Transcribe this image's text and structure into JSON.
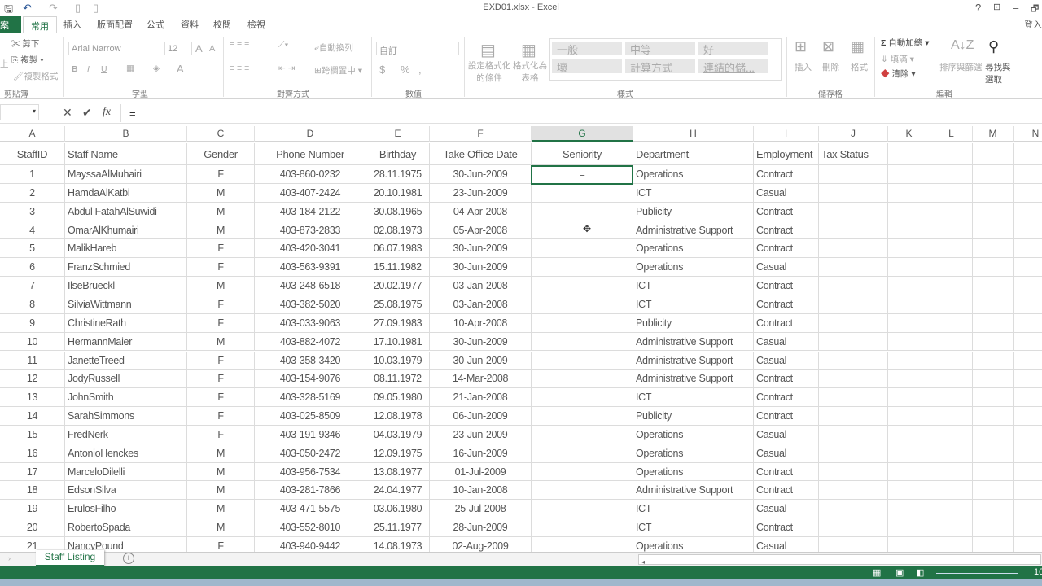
{
  "window": {
    "title": "EXD01.xlsx - Excel",
    "help": "?",
    "minimize": "–",
    "restore": "🗗",
    "signin": "登入"
  },
  "menu_tabs": [
    "案",
    "常用",
    "插入",
    "版面配置",
    "公式",
    "資料",
    "校閱",
    "檢視"
  ],
  "ribbon": {
    "clipboard": {
      "cut": "剪下",
      "copy": "複製",
      "format_painter": "複製格式",
      "paste": "上",
      "label": "剪貼簿"
    },
    "font": {
      "name": "Arial Narrow",
      "size": "12",
      "bold": "B",
      "italic": "I",
      "underline": "U",
      "grow": "A",
      "shrink": "A",
      "color": "A",
      "label": "字型"
    },
    "alignment": {
      "wrap": "自動換列",
      "merge": "跨欄置中",
      "label": "對齊方式"
    },
    "number": {
      "format": "自訂",
      "currency": "$",
      "percent": "%",
      "comma": ",",
      "label": "數值"
    },
    "styles": {
      "conditional": "設定格式化的條件",
      "as_table": "格式化為表格",
      "cells": [
        "一般",
        "中等",
        "好",
        "壞",
        "計算方式",
        "連結的儲..."
      ],
      "label": "樣式"
    },
    "cells": {
      "insert": "插入",
      "delete": "刪除",
      "format": "格式",
      "label": "儲存格"
    },
    "editing": {
      "autosum": "自動加總",
      "fill": "填滿",
      "clear": "清除",
      "sort": "排序與篩選",
      "find": "尋找與選取",
      "label": "編輯"
    }
  },
  "formula_bar": {
    "name_box": "",
    "cancel": "✕",
    "enter": "✔",
    "fx": "fx",
    "content": "="
  },
  "columns": [
    "A",
    "B",
    "C",
    "D",
    "E",
    "F",
    "G",
    "H",
    "I",
    "J",
    "K",
    "L",
    "M",
    "N"
  ],
  "selected_column": "G",
  "headers": [
    "StaffID",
    "Staff Name",
    "Gender",
    "Phone Number",
    "Birthday",
    "Take Office Date",
    "Seniority",
    "Department",
    "Employment",
    "Tax Status"
  ],
  "rows": [
    [
      "1",
      "MayssaAlMuhairi",
      "F",
      "403-860-0232",
      "28.11.1975",
      "30-Jun-2009",
      "=",
      "Operations",
      "Contract",
      ""
    ],
    [
      "2",
      "HamdaAlKatbi",
      "M",
      "403-407-2424",
      "20.10.1981",
      "23-Jun-2009",
      "",
      "ICT",
      "Casual",
      ""
    ],
    [
      "3",
      "Abdul FatahAlSuwidi",
      "M",
      "403-184-2122",
      "30.08.1965",
      "04-Apr-2008",
      "",
      "Publicity",
      "Contract",
      ""
    ],
    [
      "4",
      "OmarAlKhumairi",
      "M",
      "403-873-2833",
      "02.08.1973",
      "05-Apr-2008",
      "",
      "Administrative Support",
      "Contract",
      ""
    ],
    [
      "5",
      "MalikHareb",
      "F",
      "403-420-3041",
      "06.07.1983",
      "30-Jun-2009",
      "",
      "Operations",
      "Contract",
      ""
    ],
    [
      "6",
      "FranzSchmied",
      "F",
      "403-563-9391",
      "15.11.1982",
      "30-Jun-2009",
      "",
      "Operations",
      "Casual",
      ""
    ],
    [
      "7",
      "IlseBrueckl",
      "M",
      "403-248-6518",
      "20.02.1977",
      "03-Jan-2008",
      "",
      "ICT",
      "Contract",
      ""
    ],
    [
      "8",
      "SilviaWittmann",
      "F",
      "403-382-5020",
      "25.08.1975",
      "03-Jan-2008",
      "",
      "ICT",
      "Contract",
      ""
    ],
    [
      "9",
      "ChristineRath",
      "F",
      "403-033-9063",
      "27.09.1983",
      "10-Apr-2008",
      "",
      "Publicity",
      "Contract",
      ""
    ],
    [
      "10",
      "HermannMaier",
      "M",
      "403-882-4072",
      "17.10.1981",
      "30-Jun-2009",
      "",
      "Administrative Support",
      "Casual",
      ""
    ],
    [
      "11",
      "JanetteTreed",
      "F",
      "403-358-3420",
      "10.03.1979",
      "30-Jun-2009",
      "",
      "Administrative Support",
      "Casual",
      ""
    ],
    [
      "12",
      "JodyRussell",
      "F",
      "403-154-9076",
      "08.11.1972",
      "14-Mar-2008",
      "",
      "Administrative Support",
      "Contract",
      ""
    ],
    [
      "13",
      "JohnSmith",
      "F",
      "403-328-5169",
      "09.05.1980",
      "21-Jan-2008",
      "",
      "ICT",
      "Contract",
      ""
    ],
    [
      "14",
      "SarahSimmons",
      "F",
      "403-025-8509",
      "12.08.1978",
      "06-Jun-2009",
      "",
      "Publicity",
      "Contract",
      ""
    ],
    [
      "15",
      "FredNerk",
      "F",
      "403-191-9346",
      "04.03.1979",
      "23-Jun-2009",
      "",
      "Operations",
      "Casual",
      ""
    ],
    [
      "16",
      "AntonioHenckes",
      "M",
      "403-050-2472",
      "12.09.1975",
      "16-Jun-2009",
      "",
      "Operations",
      "Casual",
      ""
    ],
    [
      "17",
      "MarceloDilelli",
      "M",
      "403-956-7534",
      "13.08.1977",
      "01-Jul-2009",
      "",
      "Operations",
      "Contract",
      ""
    ],
    [
      "18",
      "EdsonSilva",
      "M",
      "403-281-7866",
      "24.04.1977",
      "10-Jan-2008",
      "",
      "Administrative Support",
      "Contract",
      ""
    ],
    [
      "19",
      "ErulosFilho",
      "M",
      "403-471-5575",
      "03.06.1980",
      "25-Jul-2008",
      "",
      "ICT",
      "Casual",
      ""
    ],
    [
      "20",
      "RobertoSpada",
      "M",
      "403-552-8010",
      "25.11.1977",
      "28-Jun-2009",
      "",
      "ICT",
      "Contract",
      ""
    ],
    [
      "21",
      "NancyPound",
      "F",
      "403-940-9442",
      "14.08.1973",
      "02-Aug-2009",
      "",
      "Operations",
      "Casual",
      ""
    ]
  ],
  "sheet": {
    "tab": "Staff Listing",
    "add": "+"
  },
  "status": {
    "zoom": "10"
  },
  "colors": {
    "accent": "#217346"
  }
}
